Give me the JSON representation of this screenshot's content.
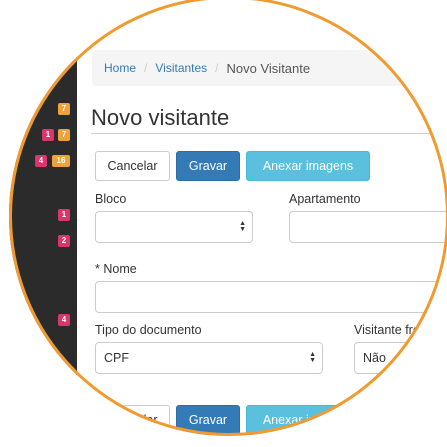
{
  "sidebar": {
    "badges": [
      {
        "text": "7",
        "color": "#f0a23a"
      },
      {
        "text": "1",
        "color": "#d9356f"
      },
      {
        "text": "7",
        "color": "#f0a23a"
      },
      {
        "text": "4",
        "color": "#d9356f"
      },
      {
        "text": "16",
        "color": "#f0a23a"
      },
      {
        "text": "1",
        "color": "#d9356f"
      },
      {
        "text": "2",
        "color": "#d9356f"
      },
      {
        "text": "4",
        "color": "#d9356f"
      }
    ]
  },
  "breadcrumb": {
    "home": "Home",
    "visitors": "Visitantes",
    "current": "Novo Visitante",
    "separator": "/"
  },
  "page": {
    "title": "Novo visitante"
  },
  "toolbar": {
    "cancel": "Cancelar",
    "save": "Gravar",
    "attach": "Anexar imagens"
  },
  "toolbar_bottom": {
    "cancel": "Cancelar",
    "save": "Gravar",
    "attach": "Anexar imagens"
  },
  "form": {
    "bloco_label": "Bloco",
    "bloco_value": "",
    "apartamento_label": "Apartamento",
    "apartamento_value": "",
    "nome_label": "* Nome",
    "nome_value": "",
    "tipo_doc_label": "Tipo do documento",
    "tipo_doc_value": "CPF",
    "visitante_label": "Visitante frequente",
    "visitante_value": "Não"
  },
  "colors": {
    "ring": "#f09a2f",
    "primary": "#337ab7",
    "info": "#5bc0de",
    "sidebar": "#2b2b2b"
  }
}
